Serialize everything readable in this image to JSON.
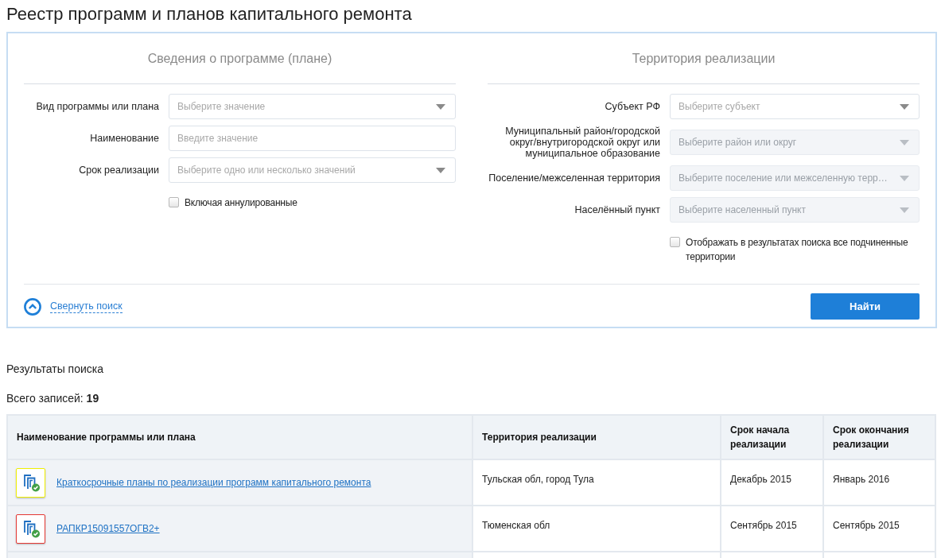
{
  "page_title": "Реестр программ и планов капитального ремонта",
  "search_panel": {
    "sections": [
      {
        "heading": "Сведения о программе (плане)",
        "fields": [
          {
            "kind": "select",
            "label": "Вид программы или плана",
            "placeholder": "Выберите значение",
            "disabled": false
          },
          {
            "kind": "text",
            "label": "Наименование",
            "placeholder": "Введите значение",
            "disabled": false
          },
          {
            "kind": "select",
            "label": "Срок реализации",
            "placeholder": "Выберите одно или несколько значений",
            "disabled": false
          }
        ],
        "checkbox": {
          "label": "Включая аннулированные",
          "checked": false
        }
      },
      {
        "heading": "Территория реализации",
        "fields": [
          {
            "kind": "select",
            "label": "Субъект РФ",
            "placeholder": "Выберите субъект",
            "disabled": false
          },
          {
            "kind": "select",
            "label": "Муниципальный район/городской округ/внутригородской округ или муниципальное образование",
            "placeholder": "Выберите район или округ",
            "disabled": true
          },
          {
            "kind": "select",
            "label": "Поселение/межселенная территория",
            "placeholder": "Выберите поселение или межселенную терр…",
            "disabled": true
          },
          {
            "kind": "select",
            "label": "Населённый пункт",
            "placeholder": "Выберите населенный пункт",
            "disabled": true
          }
        ],
        "checkbox": {
          "label": "Отображать в результатах поиска все подчиненные территории",
          "checked": false
        }
      }
    ],
    "collapse_link": "Свернуть поиск",
    "search_button": "Найти"
  },
  "results": {
    "title": "Результаты поиска",
    "total": "Всего записей: **19**",
    "table": {
      "columns": [
        "Наименование программы или плана",
        "Территория реализации",
        "Срок начала реализации",
        "Срок окончания реализации"
      ],
      "rows": [
        {
          "color": "#f0f000",
          "name": "Краткосрочные планы по реализации программ капитального ремонта",
          "territory": "Тульская обл, город Тула",
          "start": "Декабрь 2015",
          "end": "Январь 2016"
        },
        {
          "color": "#e53935",
          "name": "РАПКР15091557ОГВ2+",
          "territory": "Тюменская обл",
          "start": "Сентябрь 2015",
          "end": "Сентябрь 2015"
        }
      ]
    }
  }
}
